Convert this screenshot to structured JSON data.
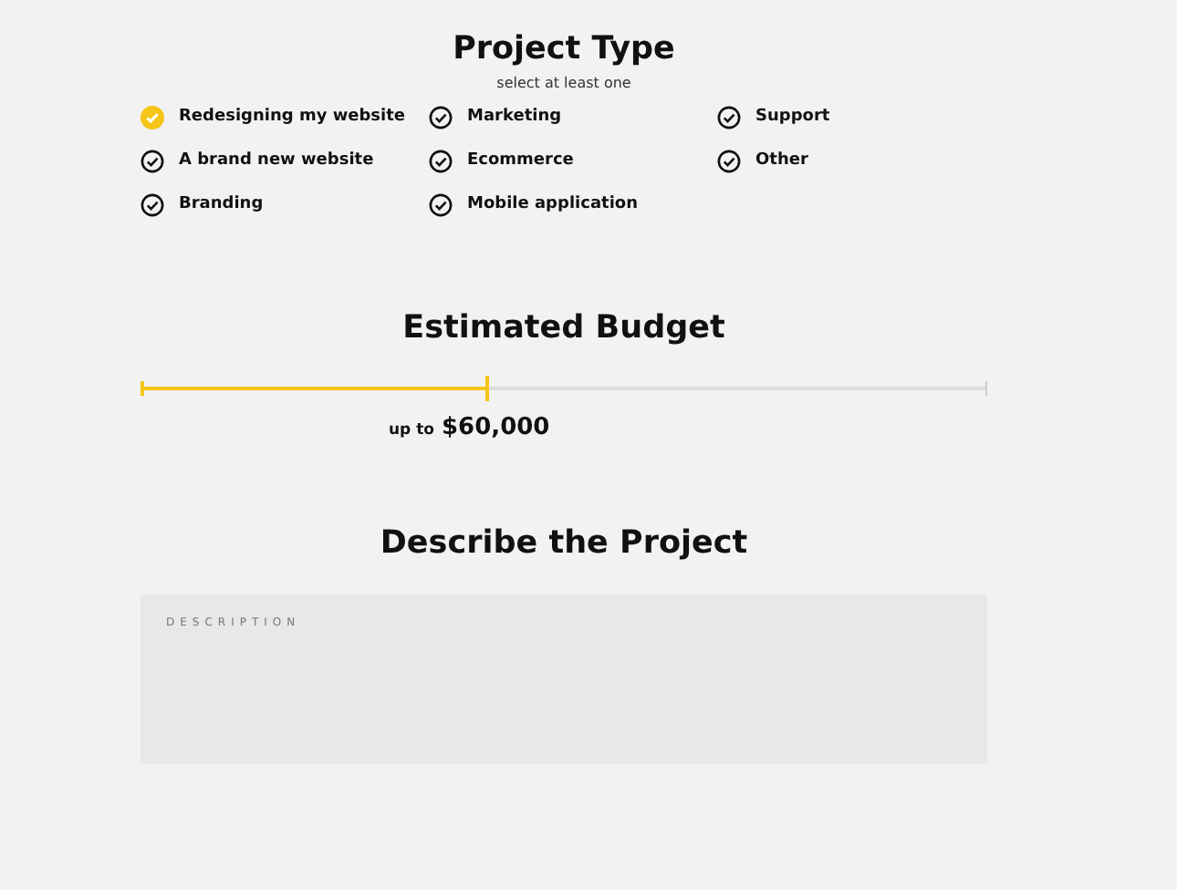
{
  "project_type": {
    "title": "Project Type",
    "subtitle": "select at least one",
    "options": [
      {
        "label": "Redesigning my website",
        "selected": true
      },
      {
        "label": "A brand new website",
        "selected": false
      },
      {
        "label": "Branding",
        "selected": false
      },
      {
        "label": "Marketing",
        "selected": false
      },
      {
        "label": "Ecommerce",
        "selected": false
      },
      {
        "label": "Mobile application",
        "selected": false
      },
      {
        "label": "Support",
        "selected": false
      },
      {
        "label": "Other",
        "selected": false
      }
    ]
  },
  "budget": {
    "title": "Estimated Budget",
    "level": 0.41,
    "prefix": "up to",
    "amount": "$60,000"
  },
  "description": {
    "title": "Describe the Project",
    "placeholder": "DESCRIPTION"
  }
}
